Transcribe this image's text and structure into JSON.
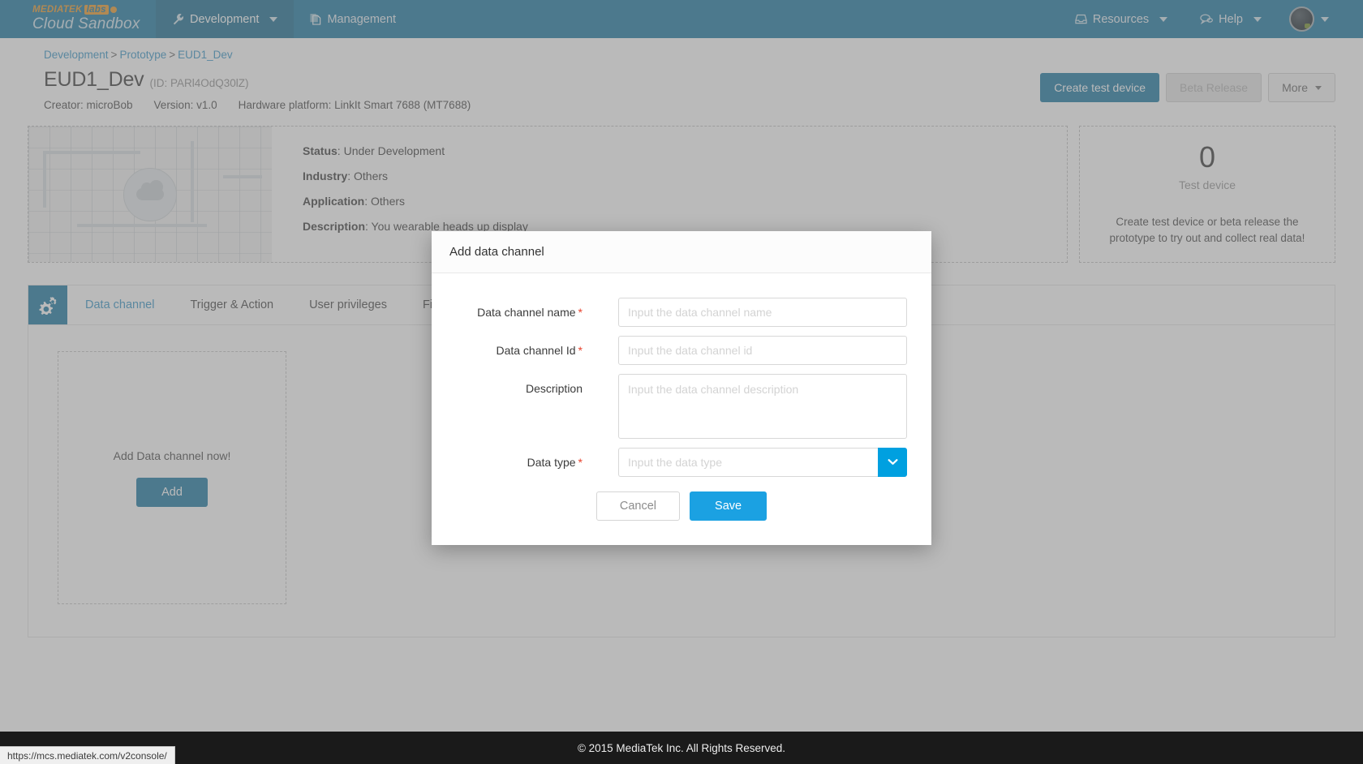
{
  "topnav": {
    "brand_labs": "MEDIATEK",
    "brand_chip": "labs",
    "brand_name": "Cloud Sandbox",
    "items": [
      {
        "label": "Development",
        "icon": "wrench-icon",
        "active": true,
        "has_caret": true
      },
      {
        "label": "Management",
        "icon": "document-icon",
        "active": false,
        "has_caret": false
      }
    ],
    "right_items": [
      {
        "label": "Resources",
        "icon": "inbox-icon",
        "has_caret": true
      },
      {
        "label": "Help",
        "icon": "chat-icon",
        "has_caret": true
      }
    ]
  },
  "breadcrumb": {
    "items": [
      "Development",
      "Prototype",
      "EUD1_Dev"
    ],
    "separator": ">"
  },
  "header": {
    "title": "EUD1_Dev",
    "id_text": "(ID: PARl4OdQ30lZ)",
    "meta": [
      "Creator: microBob",
      "Version: v1.0",
      "Hardware platform: LinkIt Smart 7688 (MT7688)"
    ],
    "actions": {
      "create_test_device": "Create test device",
      "beta_release": "Beta Release",
      "more": "More"
    }
  },
  "info": {
    "rows": [
      {
        "key": "Status",
        "value": "Under Development"
      },
      {
        "key": "Industry",
        "value": "Others"
      },
      {
        "key": "Application",
        "value": "Others"
      },
      {
        "key": "Description",
        "value": "You wearable heads up display"
      }
    ]
  },
  "device_panel": {
    "count": "0",
    "label": "Test device",
    "hint_line1": "Create test device or beta release the",
    "hint_line2": "prototype to try out and collect real data!"
  },
  "tabs": [
    {
      "label": "Data channel",
      "active": true
    },
    {
      "label": "Trigger & Action",
      "active": false
    },
    {
      "label": "User privileges",
      "active": false
    },
    {
      "label": "Firmware",
      "active": false
    }
  ],
  "empty_state": {
    "text": "Add Data channel now!",
    "add_label": "Add"
  },
  "modal": {
    "title": "Add data channel",
    "fields": [
      {
        "label": "Data channel name",
        "required": true,
        "placeholder": "Input the data channel name",
        "value": "",
        "type": "text"
      },
      {
        "label": "Data channel Id",
        "required": true,
        "placeholder": "Input the data channel id",
        "value": "",
        "type": "text"
      },
      {
        "label": "Description",
        "required": false,
        "placeholder": "Input the data channel description",
        "value": "",
        "type": "textarea"
      },
      {
        "label": "Data type",
        "required": true,
        "placeholder": "Input the data type",
        "value": "",
        "type": "select"
      }
    ],
    "required_marker": "*",
    "cancel_label": "Cancel",
    "save_label": "Save"
  },
  "footer": {
    "copyright": "© 2015 MediaTek Inc. All Rights Reserved."
  },
  "statusbar": {
    "url": "https://mcs.mediatek.com/v2console/"
  },
  "colors": {
    "brand_blue": "#0d6f9c",
    "link_blue": "#2a8fc4",
    "accent_blue": "#00a0e0",
    "save_blue": "#1ba1e2",
    "required_red": "#e8412c",
    "orange": "#e8921e"
  }
}
